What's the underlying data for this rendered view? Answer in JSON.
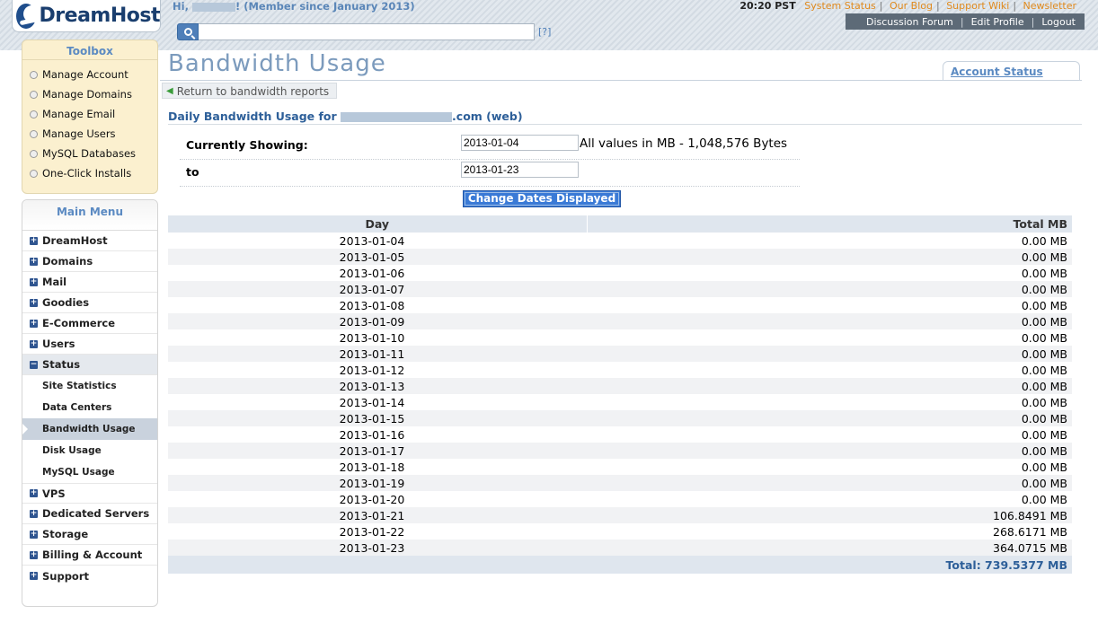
{
  "header": {
    "logo_text": "DreamHost",
    "greeting_prefix": "Hi, ",
    "greeting_suffix": "! (Member since January 2013)",
    "time": "20:20 PST",
    "links": [
      "System Status",
      "Our Blog",
      "Support Wiki",
      "Newsletter"
    ],
    "account_nav": [
      "Discussion Forum",
      "Edit Profile",
      "Logout"
    ],
    "search_placeholder": "",
    "search_help": "[?]"
  },
  "toolbox": {
    "title": "Toolbox",
    "items": [
      "Manage Account",
      "Manage Domains",
      "Manage Email",
      "Manage Users",
      "MySQL Databases",
      "One-Click Installs"
    ]
  },
  "main_menu": {
    "title": "Main Menu",
    "items_top": [
      "DreamHost",
      "Domains",
      "Mail",
      "Goodies",
      "E-Commerce",
      "Users"
    ],
    "status_label": "Status",
    "status_sub": [
      "Site Statistics",
      "Data Centers",
      "Bandwidth Usage",
      "Disk Usage",
      "MySQL Usage"
    ],
    "items_bottom": [
      "VPS",
      "Dedicated Servers",
      "Storage",
      "Billing & Account",
      "Support"
    ]
  },
  "page": {
    "title": "Bandwidth Usage",
    "account_status": "Account Status",
    "return_label": "Return to bandwidth reports",
    "subtitle_prefix": "Daily Bandwidth Usage for ",
    "subtitle_suffix": ".com (web)",
    "form": {
      "showing_label": "Currently Showing:",
      "start_date": "2013-01-04",
      "note": "All values in MB - 1,048,576 Bytes",
      "to_label": "to",
      "end_date": "2013-01-23",
      "button": "Change Dates Displayed"
    },
    "table": {
      "col_day": "Day",
      "col_total": "Total MB",
      "rows": [
        {
          "day": "2013-01-04",
          "total": "0.00 MB"
        },
        {
          "day": "2013-01-05",
          "total": "0.00 MB"
        },
        {
          "day": "2013-01-06",
          "total": "0.00 MB"
        },
        {
          "day": "2013-01-07",
          "total": "0.00 MB"
        },
        {
          "day": "2013-01-08",
          "total": "0.00 MB"
        },
        {
          "day": "2013-01-09",
          "total": "0.00 MB"
        },
        {
          "day": "2013-01-10",
          "total": "0.00 MB"
        },
        {
          "day": "2013-01-11",
          "total": "0.00 MB"
        },
        {
          "day": "2013-01-12",
          "total": "0.00 MB"
        },
        {
          "day": "2013-01-13",
          "total": "0.00 MB"
        },
        {
          "day": "2013-01-14",
          "total": "0.00 MB"
        },
        {
          "day": "2013-01-15",
          "total": "0.00 MB"
        },
        {
          "day": "2013-01-16",
          "total": "0.00 MB"
        },
        {
          "day": "2013-01-17",
          "total": "0.00 MB"
        },
        {
          "day": "2013-01-18",
          "total": "0.00 MB"
        },
        {
          "day": "2013-01-19",
          "total": "0.00 MB"
        },
        {
          "day": "2013-01-20",
          "total": "0.00 MB"
        },
        {
          "day": "2013-01-21",
          "total": "106.8491 MB"
        },
        {
          "day": "2013-01-22",
          "total": "268.6171 MB"
        },
        {
          "day": "2013-01-23",
          "total": "364.0715 MB"
        }
      ],
      "total_label": "Total: 739.5377 MB"
    }
  }
}
